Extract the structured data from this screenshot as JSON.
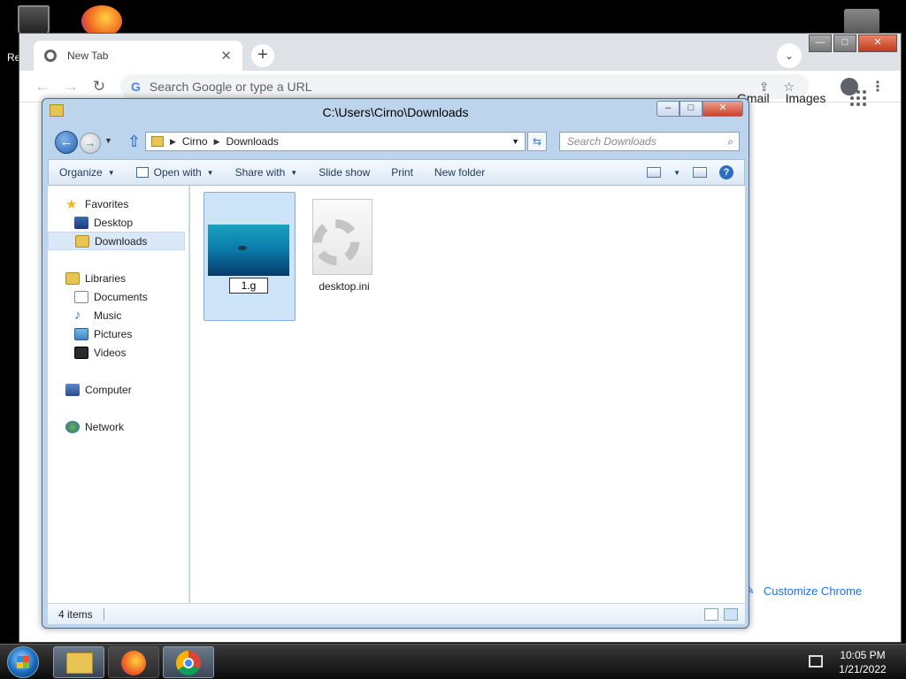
{
  "desktop": {
    "recycle_label": "Re"
  },
  "chrome": {
    "tab_title": "New Tab",
    "tab_close": "✕",
    "new_tab": "+",
    "tab_search": "⌄",
    "omnibox_placeholder": "Search Google or type a URL",
    "links": {
      "gmail": "Gmail",
      "images": "Images"
    },
    "customize_label": "Customize Chrome"
  },
  "explorer": {
    "title": "C:\\Users\\Cirno\\Downloads",
    "breadcrumb": [
      "Cirno",
      "Downloads"
    ],
    "search_placeholder": "Search Downloads",
    "commands": {
      "organize": "Organize",
      "open_with": "Open with",
      "share_with": "Share with",
      "slide_show": "Slide show",
      "print": "Print",
      "new_folder": "New folder"
    },
    "nav": {
      "favorites": "Favorites",
      "desktop": "Desktop",
      "downloads": "Downloads",
      "libraries": "Libraries",
      "documents": "Documents",
      "music": "Music",
      "pictures": "Pictures",
      "videos": "Videos",
      "computer": "Computer",
      "network": "Network"
    },
    "files": [
      {
        "name": "1.g",
        "selected": true,
        "renaming": true
      },
      {
        "name": "desktop.ini",
        "selected": false,
        "renaming": false
      }
    ],
    "status": "4 items"
  },
  "taskbar": {
    "time": "10:05 PM",
    "date": "1/21/2022"
  }
}
